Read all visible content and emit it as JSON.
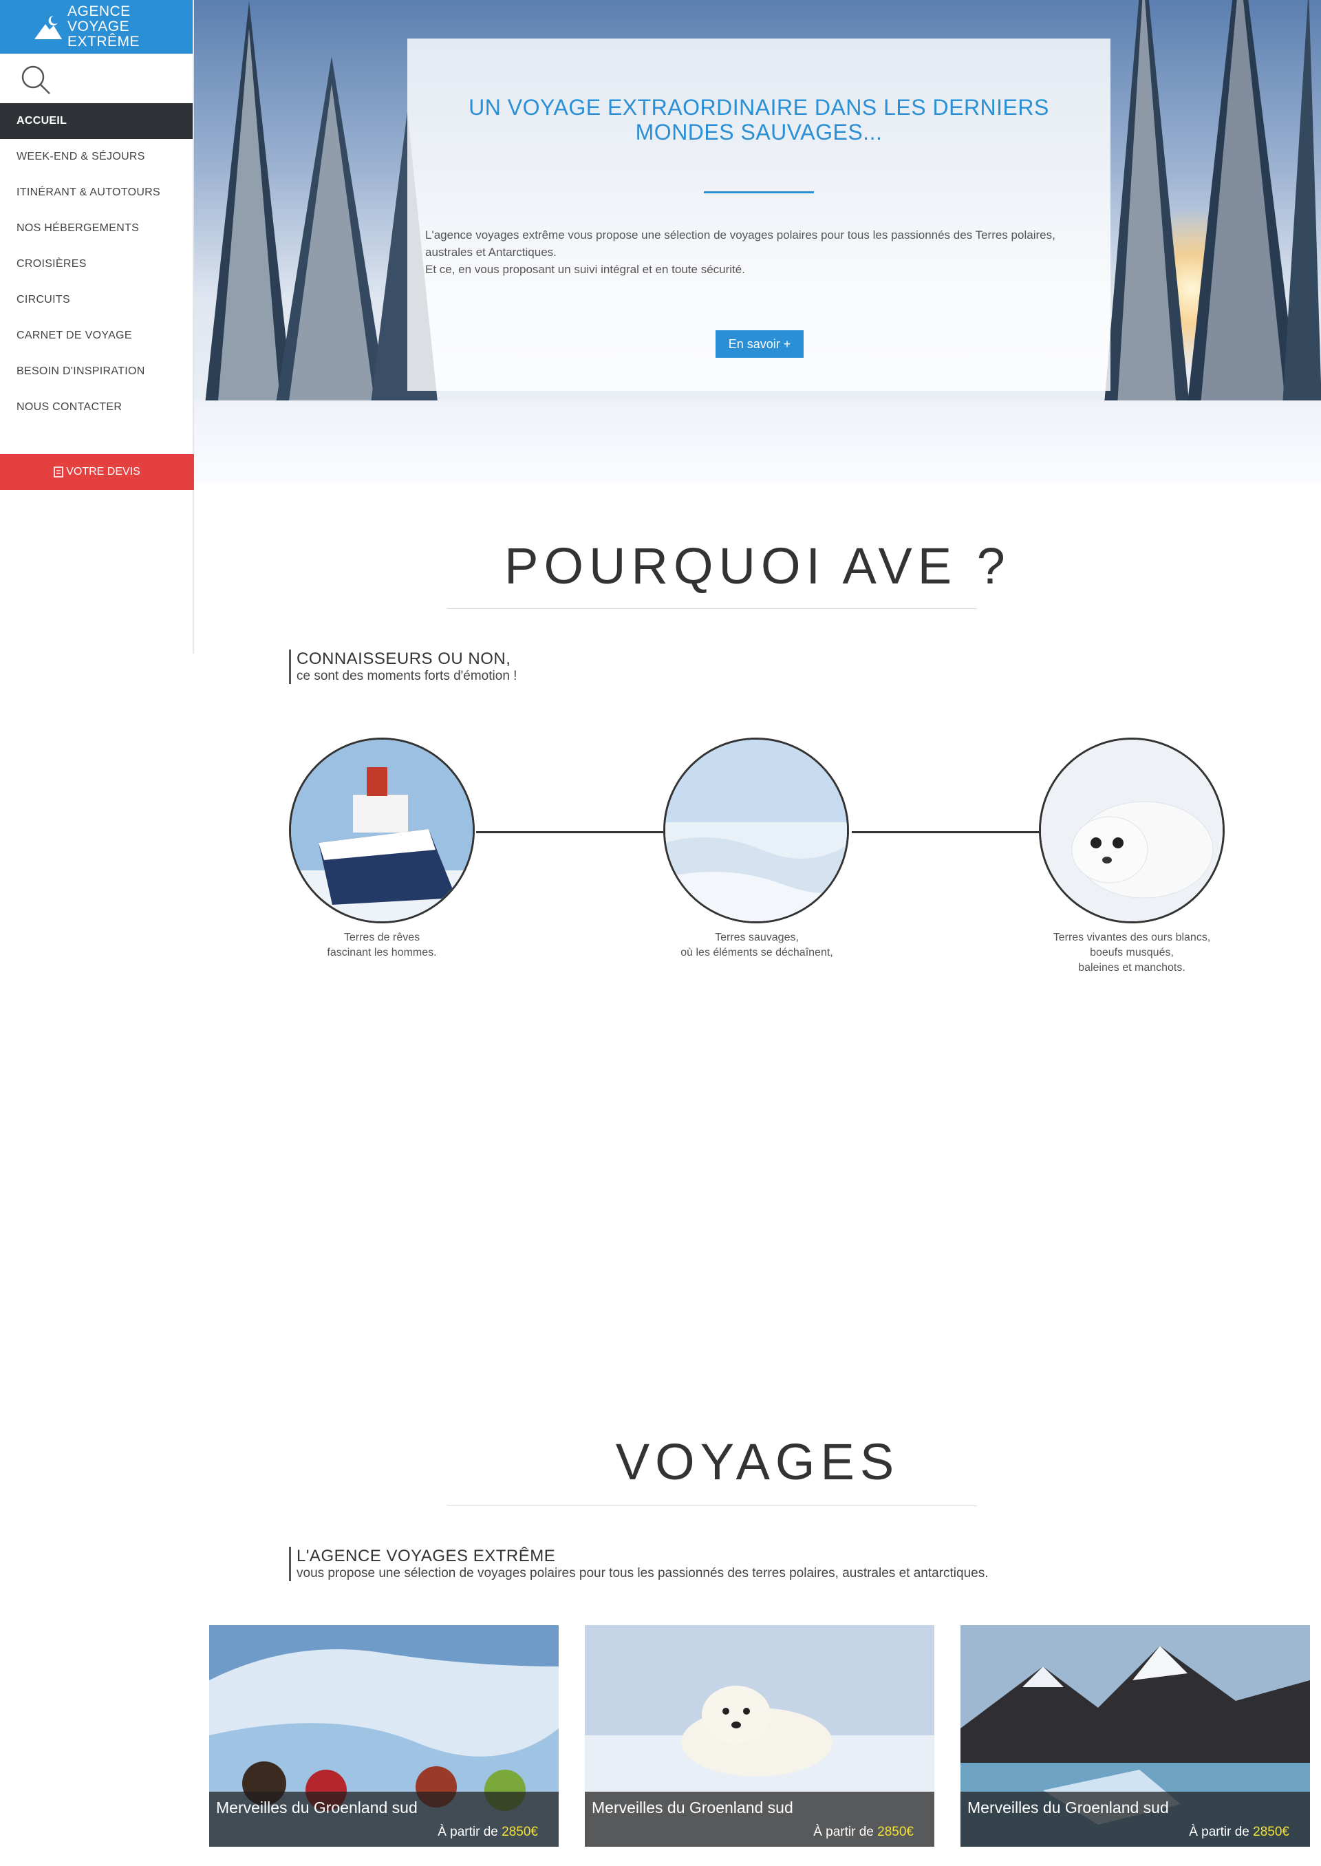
{
  "brand": {
    "line1": "AGENCE",
    "line2": "VOYAGE",
    "line3": "EXTRÊME",
    "color": "#2a8fd4"
  },
  "nav": {
    "items": [
      "ACCUEIL",
      "WEEK-END & SÉJOURS",
      "ITINÉRANT & AUTOTOURS",
      "NOS HÉBERGEMENTS",
      "CROISIÈRES",
      "CIRCUITS",
      "CARNET DE VOYAGE",
      "BESOIN D'INSPIRATION",
      "NOUS CONTACTER"
    ],
    "active": "ACCUEIL"
  },
  "devis": {
    "label": "VOTRE DEVIS",
    "color": "#e54040"
  },
  "hero": {
    "title": "UN VOYAGE EXTRAORDINAIRE DANS LES DERNIERS MONDES SAUVAGES...",
    "text1": "L'agence voyages extrême vous propose une sélection de voyages polaires pour tous les passionnés des Terres polaires, australes et Antarctiques.",
    "text2": "Et ce, en vous proposant un suivi intégral et en toute sécurité.",
    "button": "En savoir +"
  },
  "why": {
    "title": "POURQUOI AVE ?",
    "heading": "CONNAISSEURS OU NON,",
    "sub": "ce sont des moments forts d'émotion !",
    "items": [
      {
        "l1": "Terres de rêves",
        "l2": "fascinant les hommes.",
        "l3": ""
      },
      {
        "l1": "Terres sauvages,",
        "l2": "où les éléments se déchaînent,",
        "l3": ""
      },
      {
        "l1": "Terres vivantes des ours blancs,",
        "l2": "boeufs musqués,",
        "l3": "baleines et manchots."
      }
    ]
  },
  "voyages": {
    "title": "VOYAGES",
    "heading": "L'AGENCE VOYAGES EXTRÊME",
    "sub": "vous propose une sélection de voyages polaires pour tous les passionnés des terres polaires, australes et antarctiques.",
    "cards": [
      {
        "name": "Merveilles du Groenland sud",
        "prefix": "À partir de",
        "price": "2850€"
      },
      {
        "name": "Merveilles du Groenland sud",
        "prefix": "À partir de",
        "price": "2850€"
      },
      {
        "name": "Merveilles du Groenland sud",
        "prefix": "À partir de",
        "price": "2850€"
      }
    ]
  }
}
